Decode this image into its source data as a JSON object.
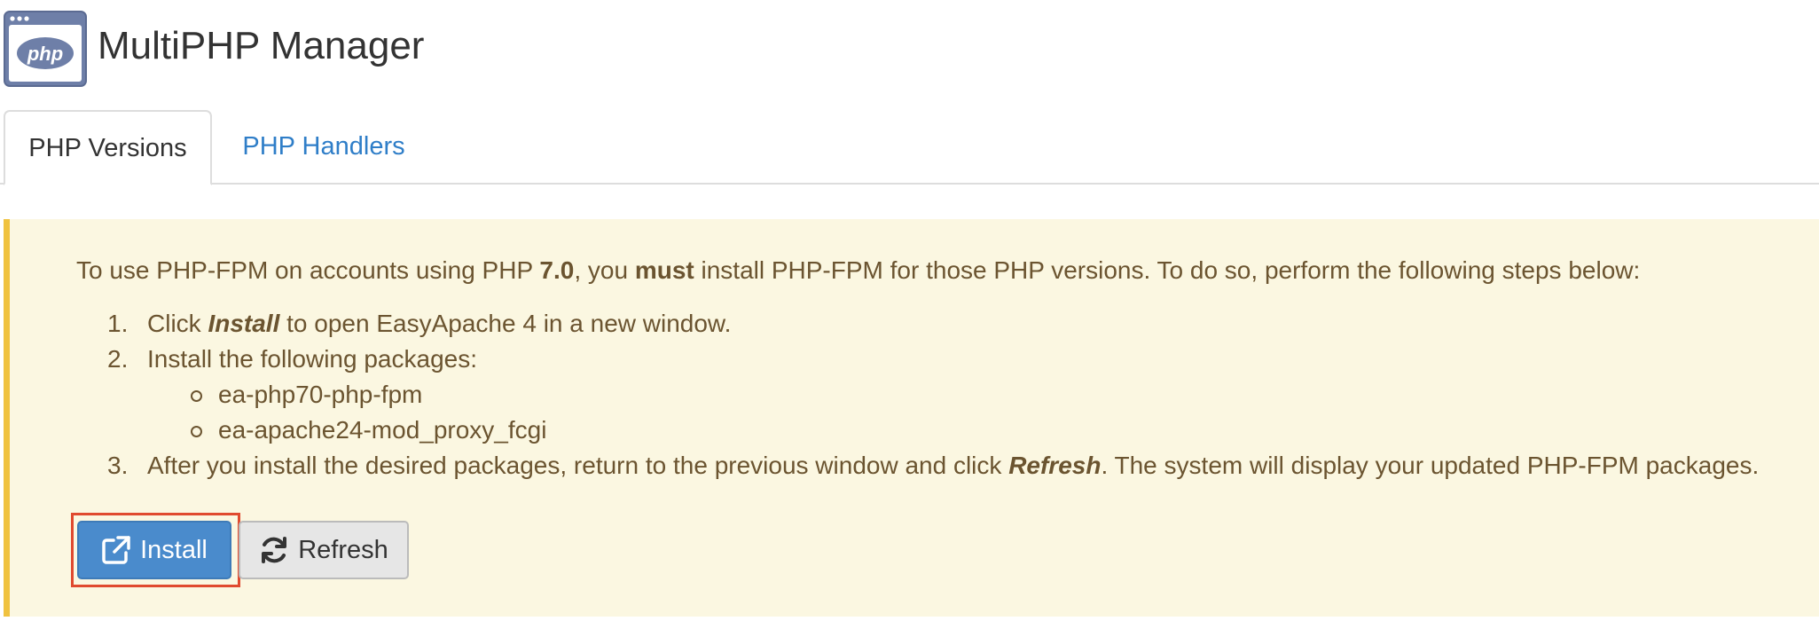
{
  "app": {
    "title": "MultiPHP Manager",
    "icon": "php-window-icon",
    "icon_text": "php"
  },
  "tabs": [
    {
      "label": "PHP Versions",
      "active": true
    },
    {
      "label": "PHP Handlers",
      "active": false
    }
  ],
  "alert": {
    "intro_prefix": "To use PHP-FPM on accounts using PHP ",
    "intro_version": "7.0",
    "intro_middle": ", you ",
    "intro_must": "must",
    "intro_suffix": " install PHP-FPM for those PHP versions. To do so, perform the following steps below:",
    "steps": [
      {
        "num": "1.",
        "prefix": "Click ",
        "emph": "Install",
        "suffix": " to open EasyApache 4 in a new window."
      },
      {
        "num": "2.",
        "text": "Install the following packages:",
        "packages": [
          "ea-php70-php-fpm",
          "ea-apache24-mod_proxy_fcgi"
        ]
      },
      {
        "num": "3.",
        "prefix": "After you install the desired packages, return to the previous window and click ",
        "emph": "Refresh",
        "suffix": ". The system will display your updated PHP-FPM packages."
      }
    ]
  },
  "buttons": {
    "install_label": "Install",
    "install_icon": "external-link-icon",
    "refresh_label": "Refresh",
    "refresh_icon": "refresh-icon"
  },
  "colors": {
    "install_button": "#4a8bcc",
    "alert_background": "#fbf7e1",
    "alert_border": "#f0c240",
    "alert_text": "#6b5430",
    "tab_link": "#2f7ec8",
    "highlight": "#e04a2f"
  }
}
